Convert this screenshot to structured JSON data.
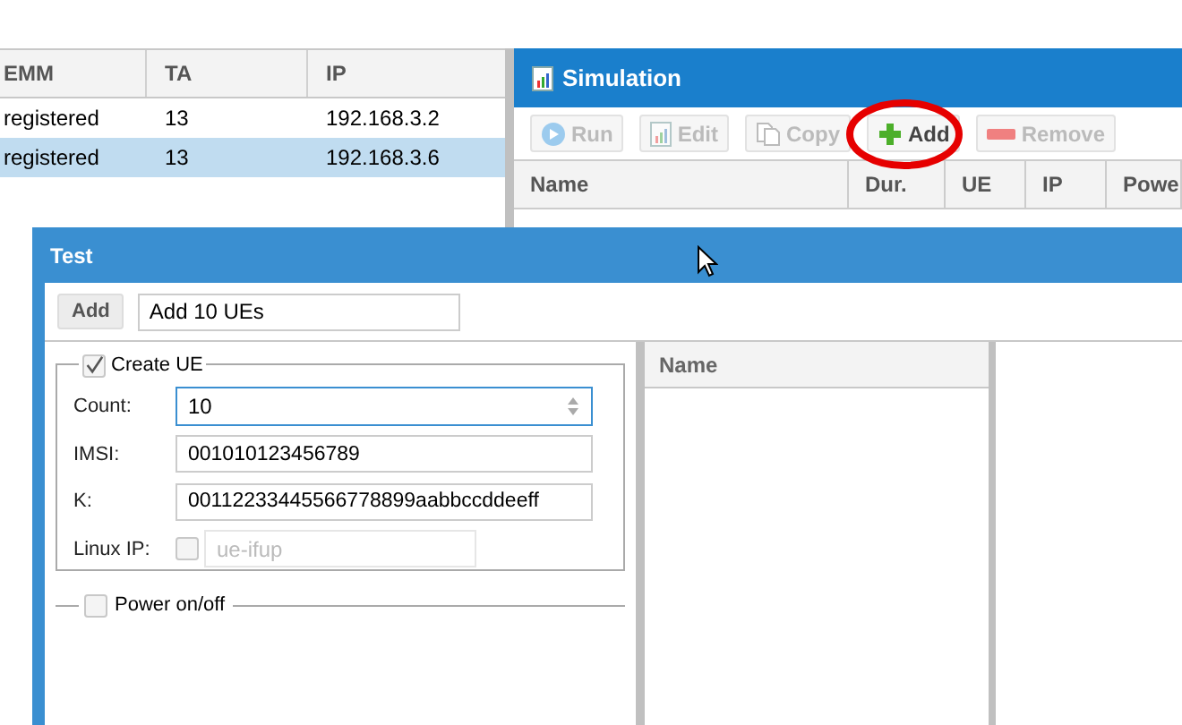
{
  "ue_table": {
    "columns": [
      "EMM",
      "TA",
      "IP"
    ],
    "rows": [
      {
        "cells": [
          "registered",
          "13",
          "192.168.3.2"
        ],
        "selected": false
      },
      {
        "cells": [
          "registered",
          "13",
          "192.168.3.6"
        ],
        "selected": true
      }
    ]
  },
  "simulation": {
    "title": "Simulation",
    "toolbar": [
      {
        "label": "Run",
        "kind": "run",
        "disabled": true,
        "highlighted": false
      },
      {
        "label": "Edit",
        "kind": "edit",
        "disabled": true,
        "highlighted": false
      },
      {
        "label": "Copy",
        "kind": "copy",
        "disabled": true,
        "highlighted": false
      },
      {
        "label": "Add",
        "kind": "add",
        "disabled": false,
        "highlighted": true
      },
      {
        "label": "Remove",
        "kind": "remove",
        "disabled": true,
        "highlighted": false
      }
    ],
    "columns": [
      "Name",
      "Dur.",
      "UE",
      "IP",
      "Powe"
    ]
  },
  "test": {
    "title": "Test",
    "add_button": "Add",
    "name_value": "Add 10 UEs",
    "create_ue": {
      "label": "Create UE",
      "checked": true,
      "fields": [
        {
          "kind": "spin",
          "label": "Count:",
          "value": "10"
        },
        {
          "kind": "text",
          "label": "IMSI:",
          "value": "001010123456789"
        },
        {
          "kind": "text",
          "label": "K:",
          "value": "00112233445566778899aabbccddeeff"
        },
        {
          "kind": "check-text",
          "label": "Linux IP:",
          "checked": false,
          "placeholder": "ue-ifup"
        }
      ]
    },
    "power": {
      "label": "Power on/off",
      "checked": false
    },
    "list_column": "Name"
  }
}
